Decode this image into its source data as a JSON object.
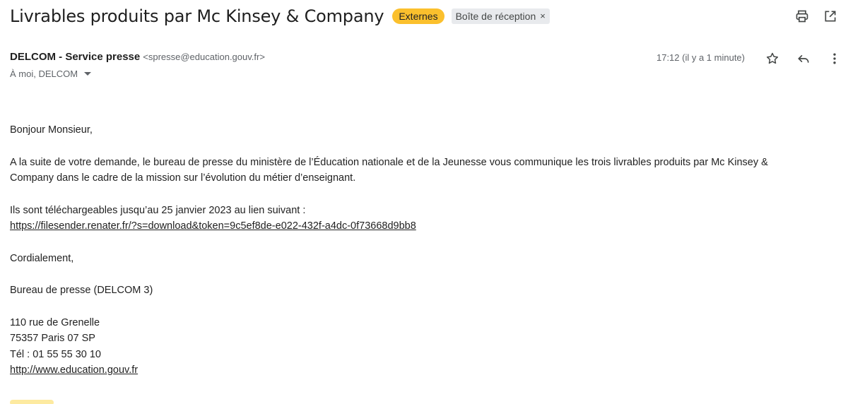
{
  "header": {
    "subject": "Livrables produits par Mc Kinsey & Company",
    "badge_externes": "Externes",
    "label_inbox": "Boîte de réception",
    "label_remove": "×"
  },
  "icons": {
    "print": "print-icon",
    "open_new_window": "open-in-new-icon",
    "star": "star-icon",
    "reply": "reply-icon",
    "more": "more-vert-icon"
  },
  "message": {
    "sender_name": "DELCOM - Service presse",
    "sender_email": "<spresse@education.gouv.fr>",
    "recipients": "À moi, DELCOM",
    "time": "17:12 (il y a 1 minute)"
  },
  "body": {
    "greeting": "Bonjour Monsieur,",
    "paragraph1_line1": "A la suite de votre demande, le bureau de presse du ministère de l’Éducation nationale et de la Jeunesse vous communique les trois livrables produits par Mc Kinsey &",
    "paragraph1_line2": "Company dans le cadre de la mission sur l’évolution du métier d’enseignant.",
    "paragraph2_line1": "Ils sont téléchargeables jusqu’au 25 janvier 2023 au lien suivant :",
    "download_link": "https://filesender.renater.fr/?s=download&token=9c5ef8de-e022-432f-a4dc-0f73668d9bb8",
    "closing": "Cordialement,",
    "signature_name": "Bureau de presse (DELCOM 3)",
    "address_line1": "110 rue de Grenelle",
    "address_line2": "75357 Paris 07 SP",
    "phone": "Tél : 01 55 55 30 10",
    "website": "http://www.education.gouv.fr"
  },
  "colors": {
    "badge_externes_bg": "#fbc02d",
    "label_bg": "#e8eaed",
    "text": "#222222",
    "muted": "#5f6368"
  }
}
